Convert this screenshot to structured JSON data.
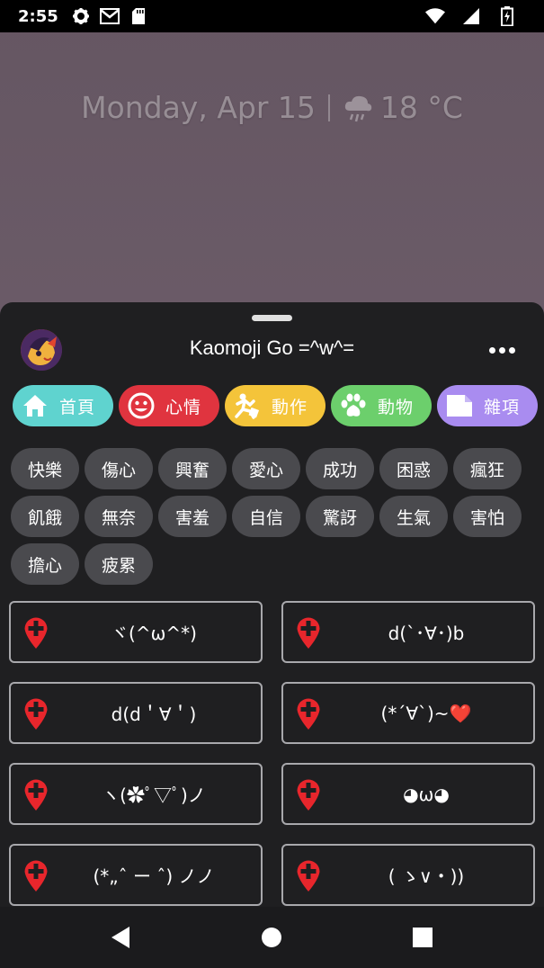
{
  "status_bar": {
    "time": "2:55",
    "left_icons": [
      "gear-icon",
      "gmail-icon",
      "sd-card-icon"
    ],
    "right_icons": [
      "wifi-icon",
      "signal-icon",
      "battery-icon"
    ]
  },
  "home_widget": {
    "date": "Monday, Apr 15",
    "weather_icon": "rain-cloud-icon",
    "temperature": "18 °C"
  },
  "sheet": {
    "app_title": "Kaomoji Go =^w^=",
    "more_icon": "more-horizontal-icon"
  },
  "category_tabs": [
    {
      "label": "首頁",
      "icon": "home-icon",
      "color": "#5fd3cf"
    },
    {
      "label": "心情",
      "icon": "smiley-icon",
      "color": "#e0343f"
    },
    {
      "label": "動作",
      "icon": "person-action-icon",
      "color": "#f4c43a"
    },
    {
      "label": "動物",
      "icon": "paw-icon",
      "color": "#6ccf6c"
    },
    {
      "label": "雜項",
      "icon": "document-icon",
      "color": "#a98cf0"
    }
  ],
  "mood_chips": [
    "快樂",
    "傷心",
    "興奮",
    "愛心",
    "成功",
    "困惑",
    "瘋狂",
    "飢餓",
    "無奈",
    "害羞",
    "自信",
    "驚訝",
    "生氣",
    "害怕",
    "擔心",
    "疲累"
  ],
  "kaomoji": [
    "ヾ(^ω^*)",
    "d(`･∀･)b",
    "d(d＇∀＇)",
    "(*´∀`)~❤️",
    "ヽ(✿ﾟ▽ﾟ)ノ",
    "◕ω◕",
    "(*„ˆ ー ˆ) ノノ",
    "( ゝ∨・))"
  ],
  "colors": {
    "pin": "#e8262c",
    "sheet_background": "#1f1f21",
    "chip_background": "#4a4a4e",
    "card_border": "#a8a8ac"
  },
  "nav_bar": {
    "buttons": [
      "back-icon",
      "home-circle-icon",
      "recents-square-icon"
    ]
  }
}
